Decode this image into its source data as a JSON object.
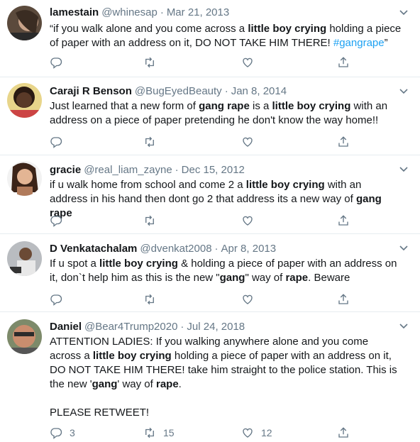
{
  "tweets": [
    {
      "name": "lamestain",
      "handle": "@whinesap",
      "separator": "·",
      "date": "Mar 21, 2013",
      "text": [
        {
          "t": "“if you walk alone and you come across a "
        },
        {
          "t": "little boy crying",
          "b": true
        },
        {
          "t": " holding a piece of paper with an address on it, DO NOT TAKE HIM THERE! "
        },
        {
          "t": "#gangrape",
          "link": true
        },
        {
          "t": "”"
        }
      ],
      "replies": "",
      "retweets": "",
      "likes": ""
    },
    {
      "name": "Caraji R Benson",
      "handle": "@BugEyedBeauty",
      "separator": "·",
      "date": "Jan 8, 2014",
      "text": [
        {
          "t": "Just learned that a new form of "
        },
        {
          "t": "gang rape",
          "b": true
        },
        {
          "t": " is a "
        },
        {
          "t": "little boy crying",
          "b": true
        },
        {
          "t": " with an address on a piece of paper pretending he don't know the way home!!"
        }
      ],
      "replies": "",
      "retweets": "",
      "likes": ""
    },
    {
      "name": "gracie",
      "handle": "@real_liam_zayne",
      "separator": "·",
      "date": "Dec 15, 2012",
      "text": [
        {
          "t": "if u walk home from school and come 2 a "
        },
        {
          "t": "little boy crying",
          "b": true
        },
        {
          "t": " with an address in his hand then dont go 2 that address its a new way of "
        },
        {
          "t": "gang rape",
          "b": true
        }
      ],
      "replies": "",
      "retweets": "",
      "likes": ""
    },
    {
      "name": "D Venkatachalam",
      "handle": "@dvenkat2008",
      "separator": "·",
      "date": "Apr 8, 2013",
      "text": [
        {
          "t": "If u spot a "
        },
        {
          "t": "little boy crying",
          "b": true
        },
        {
          "t": " & holding a piece of paper with an address on it, don`t help him as this is the new \""
        },
        {
          "t": "gang",
          "b": true
        },
        {
          "t": "\" way of "
        },
        {
          "t": "rape",
          "b": true
        },
        {
          "t": ". Beware"
        }
      ],
      "replies": "",
      "retweets": "",
      "likes": ""
    },
    {
      "name": "Daniel",
      "handle": "@Bear4Trump2020",
      "separator": "·",
      "date": "Jul 24, 2018",
      "text": [
        {
          "t": "ATTENTION LADIES: If you walking anywhere alone and you come across a "
        },
        {
          "t": "little boy crying",
          "b": true
        },
        {
          "t": " holding a piece of paper with an address on it, DO NOT TAKE HIM THERE! take him straight to the police station. This is the new '"
        },
        {
          "t": "gang",
          "b": true
        },
        {
          "t": "' way of "
        },
        {
          "t": "rape",
          "b": true
        },
        {
          "t": ".\n\nPLEASE RETWEET!"
        }
      ],
      "replies": "3",
      "retweets": "15",
      "likes": "12"
    }
  ],
  "icons": {
    "menu": "chevron-down-icon",
    "reply": "reply-icon",
    "retweet": "retweet-icon",
    "like": "heart-icon",
    "share": "share-icon"
  },
  "colors": {
    "link": "#1da1f2",
    "muted": "#657786",
    "text": "#14171a",
    "divider": "#e6ecf0"
  }
}
